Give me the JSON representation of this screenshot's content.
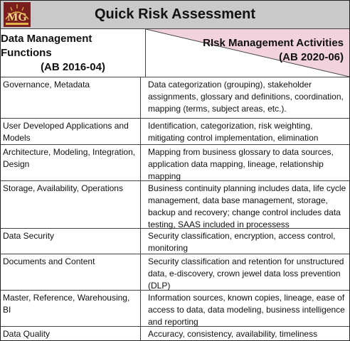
{
  "title": "Quick Risk Assessment",
  "logo": {
    "letters": "MG",
    "icon": "mg-logo-icon"
  },
  "header": {
    "left_line1": "Data Management Functions",
    "left_line2": "(AB 2016-04)",
    "right_line1": "RIsk Management Activities",
    "right_line2": "(AB 2020-06)"
  },
  "colors": {
    "title_bg": "#c9c9c9",
    "header_tint": "#f2d2dc"
  },
  "rows": [
    {
      "function": "Governance, Metadata",
      "activity": "Data categorization (grouping), stakeholder assignments, glossary and definitions, coordination, mapping (terms, subject areas, etc.)."
    },
    {
      "function": "User Developed Applications and Models",
      "activity": "Identification, categorization, risk weighting, mitigating control implementation, elimination"
    },
    {
      "function": "Architecture, Modeling, Integration, Design",
      "activity": "Mapping from business glossary to data sources, application data mapping, lineage, relationship mapping"
    },
    {
      "function": "Storage, Availability, Operations",
      "activity": "Business continuity planning includes data, life cycle management, data base management, storage, backup and recovery; change control includes data testing, SAAS included in processess"
    },
    {
      "function": "Data Security",
      "activity": "Security classification, encryption, access control, monitoring"
    },
    {
      "function": "Documents and Content",
      "activity": "Security classification and retention for unstructured data, e-discovery, crown jewel data loss prevention (DLP)"
    },
    {
      "function": "Master, Reference, Warehousing, BI",
      "activity": "Information sources, known copies, lineage, ease of access to data,  data modeling, business intelligence and reporting"
    },
    {
      "function": "Data Quality",
      "activity": "Accuracy, consistency, availability, timeliness"
    }
  ]
}
